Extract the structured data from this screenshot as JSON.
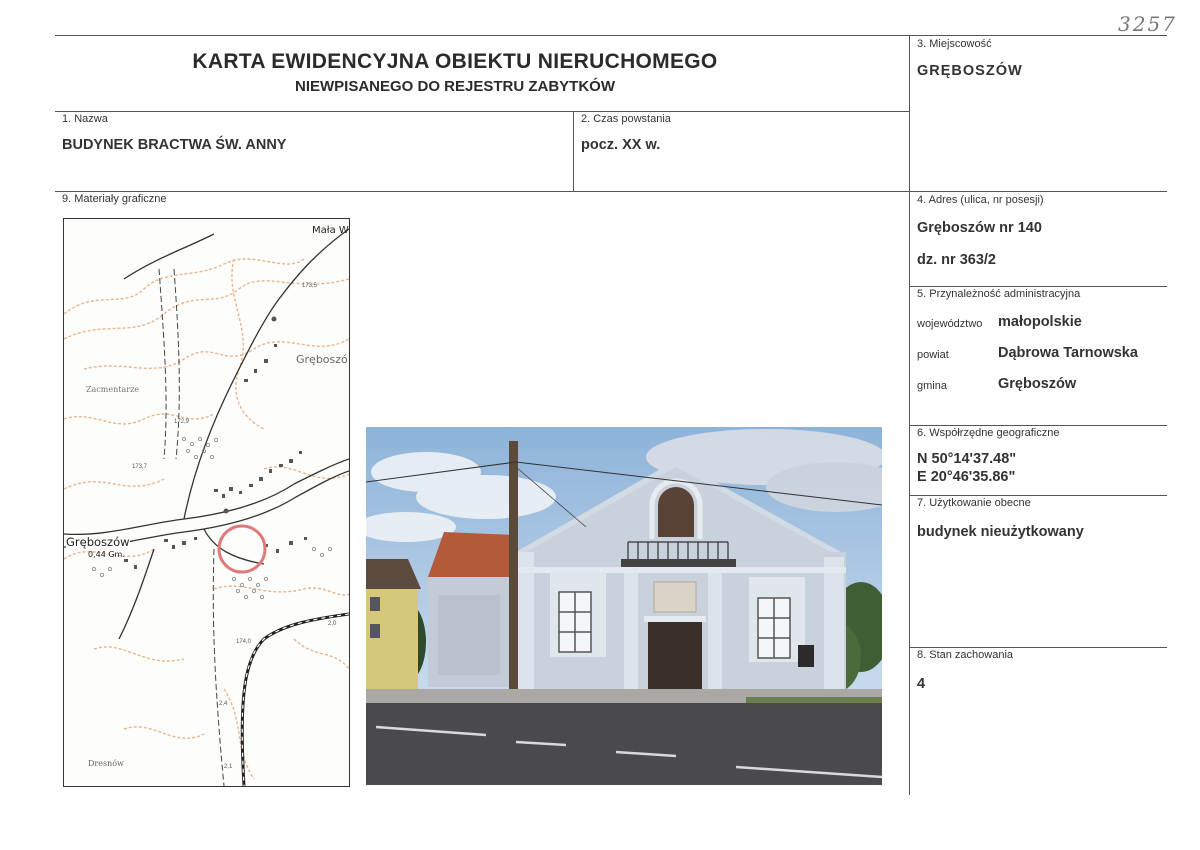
{
  "archive_number": "3257",
  "header": {
    "title": "KARTA EWIDENCYJNA OBIEKTU NIERUCHOMEGO",
    "subtitle": "NIEWPISANEGO DO REJESTRU ZABYTKÓW"
  },
  "fields": {
    "nazwa": {
      "label": "1. Nazwa",
      "value": "BUDYNEK BRACTWA ŚW. ANNY"
    },
    "czas": {
      "label": "2. Czas powstania",
      "value": "pocz. XX w."
    },
    "miejscowosc": {
      "label": "3. Miejscowość",
      "value": "GRĘBOSZÓW"
    },
    "adres": {
      "label": "4. Adres (ulica, nr posesji)",
      "line1": "Gręboszów nr 140",
      "line2": "dz. nr 363/2"
    },
    "przynaleznosc": {
      "label": "5. Przynależność administracyjna",
      "wojewodztwo_label": "województwo",
      "wojewodztwo": "małopolskie",
      "powiat_label": "powiat",
      "powiat": "Dąbrowa Tarnowska",
      "gmina_label": "gmina",
      "gmina": "Gręboszów"
    },
    "wspolrzedne": {
      "label": "6. Współrzędne geograficzne",
      "n": "N 50°14'37.48\"",
      "e": "E 20°46'35.86\""
    },
    "uzytkowanie": {
      "label": "7. Użytkowanie obecne",
      "value": "budynek nieużytkowany"
    },
    "stan": {
      "label": "8. Stan zachowania",
      "value": "4"
    },
    "materialy": {
      "label": "9. Materiały graficzne"
    }
  },
  "map": {
    "labels": {
      "mala": "Mała W",
      "greboszow_east": "Gręboszó",
      "zacmentarze": "Zacmentarze",
      "greboszow_west": "Gręboszów",
      "gm": "0,44 Gm.",
      "dresnow": "Dresnów",
      "h1735": "173,5",
      "h1729": "172,9",
      "h1737": "173,7",
      "h1740": "174,0",
      "v20": "2,0",
      "v24": "2,4",
      "v21": "2,1"
    }
  },
  "colors": {
    "marker": "#e07a7a",
    "contour": "#e7b58f",
    "sky": "#a9c6e3",
    "wall": "#c9d2dc"
  }
}
